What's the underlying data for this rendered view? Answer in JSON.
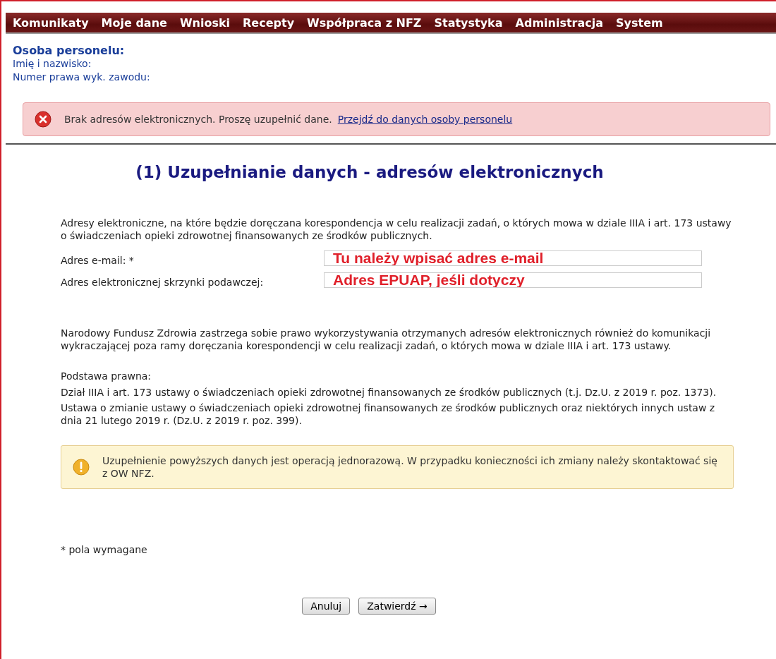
{
  "menu": [
    {
      "label": "Komunikaty"
    },
    {
      "label": "Moje dane"
    },
    {
      "label": "Wnioski"
    },
    {
      "label": "Recepty"
    },
    {
      "label": "Współpraca z NFZ"
    },
    {
      "label": "Statystyka"
    },
    {
      "label": "Administracja"
    },
    {
      "label": "System"
    }
  ],
  "person": {
    "heading": "Osoba personelu:",
    "fields": [
      "Imię i nazwisko:",
      "Numer prawa wyk. zawodu:"
    ]
  },
  "error_alert": {
    "text": "Brak adresów elektronicznych. Proszę uzupełnić dane.",
    "link": "Przejdź do danych osoby personelu"
  },
  "title": "(1) Uzupełnianie danych - adresów elektronicznych",
  "intro": "Adresy elektroniczne, na które będzie doręczana korespondencja w celu realizacji zadań, o których mowa w dziale IIIA i art. 173 ustawy o świadczeniach opieki zdrowotnej finansowanych ze środków publicznych.",
  "form": [
    {
      "label": "Adres e-mail: *",
      "value": "Tu należy wpisać adres e-mail"
    },
    {
      "label": "Adres elektronicznej skrzynki podawczej:",
      "value": "Adres EPUAP, jeśli dotyczy"
    }
  ],
  "notice": "Narodowy Fundusz Zdrowia zastrzega sobie prawo wykorzystywania otrzymanych adresów elektronicznych również do komunikacji wykraczającej poza ramy doręczania korespondencji w celu realizacji zadań, o których mowa w dziale IIIA i art. 173 ustawy.",
  "legal": {
    "heading": "Podstawa prawna:",
    "items": [
      "Dział IIIA i art. 173 ustawy o świadczeniach opieki zdrowotnej finansowanych ze środków publicznych (t.j. Dz.U. z 2019 r. poz. 1373).",
      "Ustawa o zmianie ustawy o świadczeniach opieki zdrowotnej finansowanych ze środków publicznych oraz niektórych innych ustaw z dnia 21 lutego 2019 r. (Dz.U. z 2019 r. poz. 399)."
    ]
  },
  "warning_alert": {
    "text": "Uzupełnienie powyższych danych jest operacją jednorazową. W przypadku konieczności ich zmiany należy skontaktować się z OW NFZ."
  },
  "required_note": "* pola wymagane",
  "buttons": [
    "Anuluj",
    "Zatwierdź →"
  ]
}
